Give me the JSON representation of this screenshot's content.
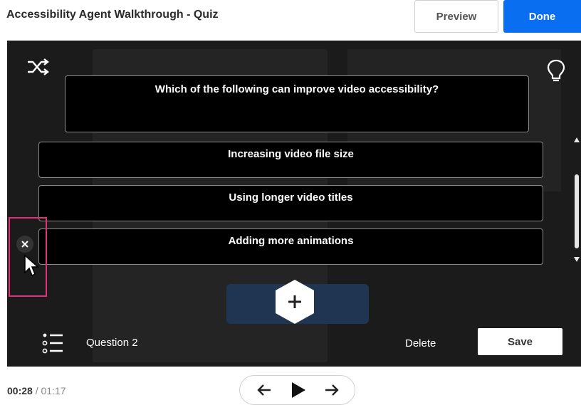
{
  "header": {
    "title": "Accessibility Agent Walkthrough - Quiz",
    "preview_label": "Preview",
    "done_label": "Done"
  },
  "quiz": {
    "question": "Which of the following can improve video accessibility?",
    "answers": [
      "Increasing video file size",
      "Using longer video titles",
      "Adding more animations"
    ],
    "question_label": "Question 2",
    "delete_label": "Delete",
    "save_label": "Save"
  },
  "player": {
    "current_time": "00:28",
    "separator": "/",
    "duration": "01:17"
  },
  "icons": {
    "shuffle": "shuffle-icon",
    "lightbulb": "lightbulb-icon",
    "remove": "close-icon",
    "cursor": "cursor-icon",
    "add": "plus-icon",
    "list": "list-icon",
    "prev": "arrow-left-icon",
    "play": "play-icon",
    "next": "arrow-right-icon"
  },
  "colors": {
    "primary": "#0a6ef0",
    "highlight": "#e0317a",
    "stage": "#1b1b1b"
  }
}
